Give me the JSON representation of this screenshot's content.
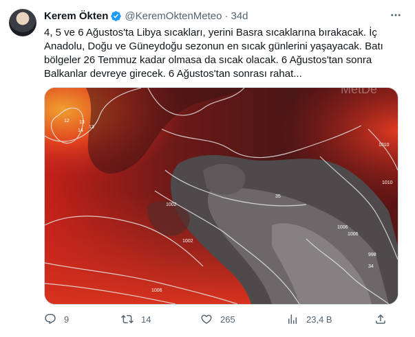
{
  "author": {
    "name": "Kerem Ökten",
    "handle": "@KeremOktenMeteo",
    "separator": "·",
    "time": "34d",
    "verified": true,
    "brand_blue": "#1d9bf0"
  },
  "tweet": {
    "text": "4, 5 ve 6 Ağustos'ta Libya sıcakları, yerini Basra sıcaklarına bırakacak. İç Anadolu, Doğu ve Güneydoğu sezonun en sıcak günlerini yaşayacak. Batı bölgeler 26 Temmuz kadar olmasa da sıcak olacak. 6 Ağustos'tan sonra Balkanlar devreye girecek. 6 Ağustos'tan sonrası rahat..."
  },
  "media": {
    "watermark": "MetDe",
    "map_labels": [
      "12",
      "13",
      "14",
      "13",
      "1002",
      "1002",
      "1006",
      "1006",
      "1010",
      "1010",
      "1006",
      "998",
      "35",
      "34"
    ]
  },
  "actions": {
    "reply_count": "9",
    "retweet_count": "14",
    "like_count": "265",
    "views_count": "23,4 B"
  }
}
